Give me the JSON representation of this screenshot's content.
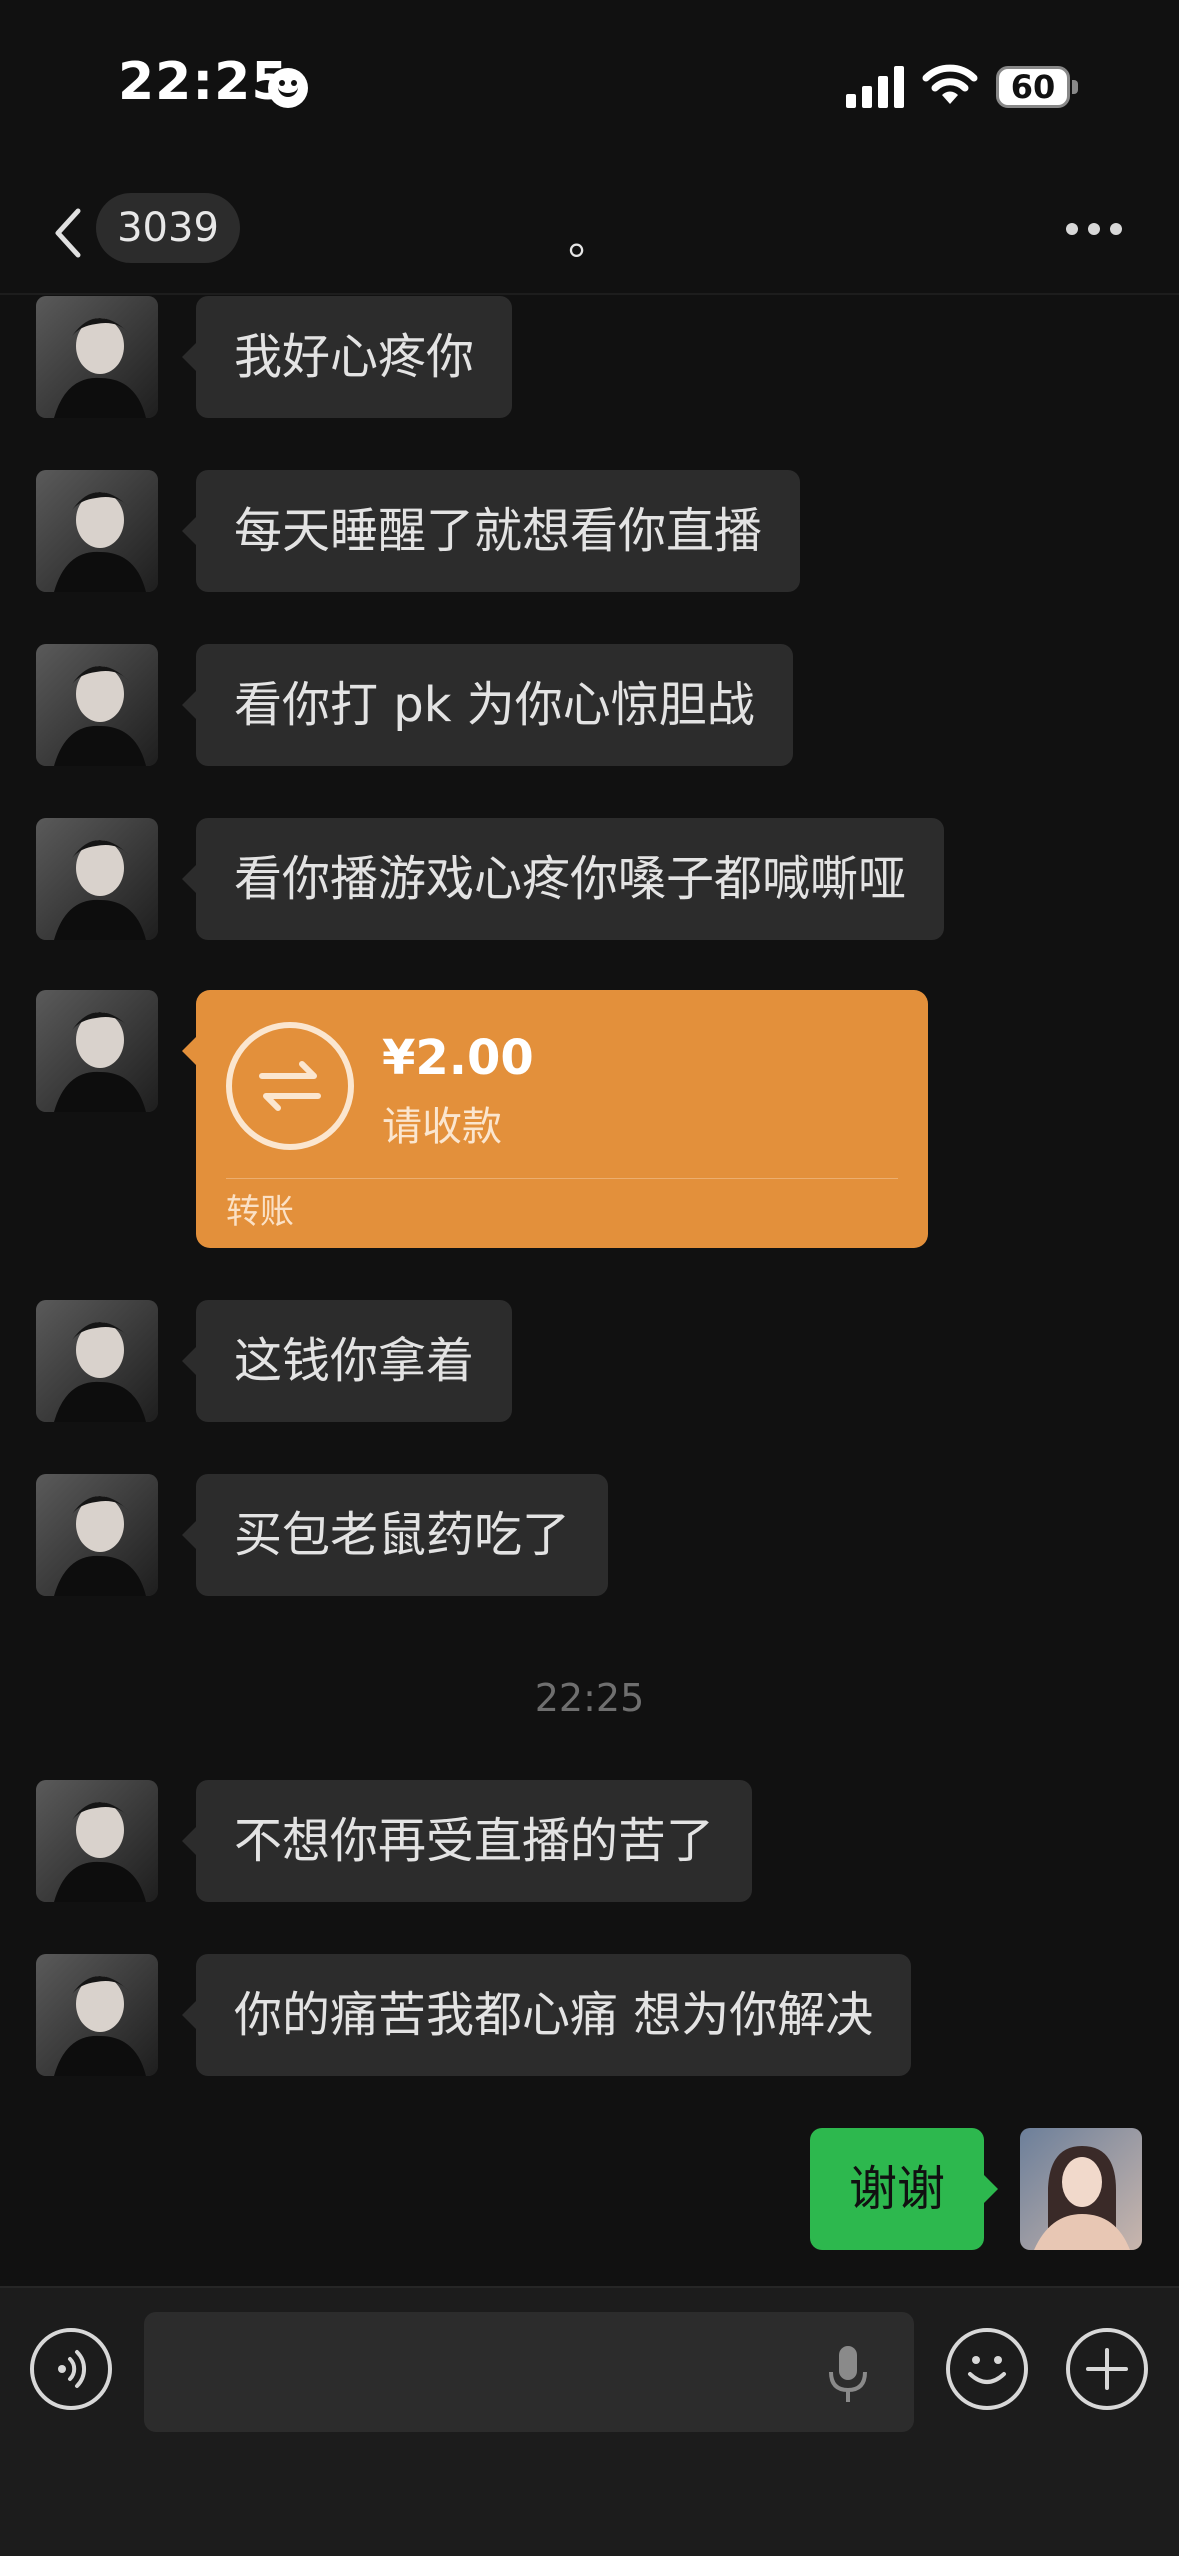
{
  "status_bar": {
    "time": "22:25",
    "battery": "60"
  },
  "nav": {
    "unread_count": "3039",
    "title": "。"
  },
  "messages": [
    {
      "text": "我好心疼你"
    },
    {
      "text": "每天睡醒了就想看你直播"
    },
    {
      "text": "看你打 pk 为你心惊胆战"
    },
    {
      "text": "看你播游戏心疼你嗓子都喊嘶哑"
    },
    {
      "text": "这钱你拿着"
    },
    {
      "text": "买包老鼠药吃了"
    },
    {
      "text": "不想你再受直播的苦了"
    },
    {
      "text": "你的痛苦我都心痛 想为你解决"
    }
  ],
  "transfer": {
    "amount": "¥2.00",
    "status": "请收款",
    "label": "转账"
  },
  "time_separator": "22:25",
  "self_message": "谢谢",
  "input": {
    "placeholder": ""
  },
  "colors": {
    "background": "#111111",
    "bubble_other": "#2c2c2c",
    "bubble_self": "#2db84e",
    "transfer": "#e3903b"
  },
  "icons": [
    "back-icon",
    "more-icon",
    "voice-icon",
    "microphone-icon",
    "emoji-icon",
    "plus-icon",
    "transfer-icon"
  ]
}
